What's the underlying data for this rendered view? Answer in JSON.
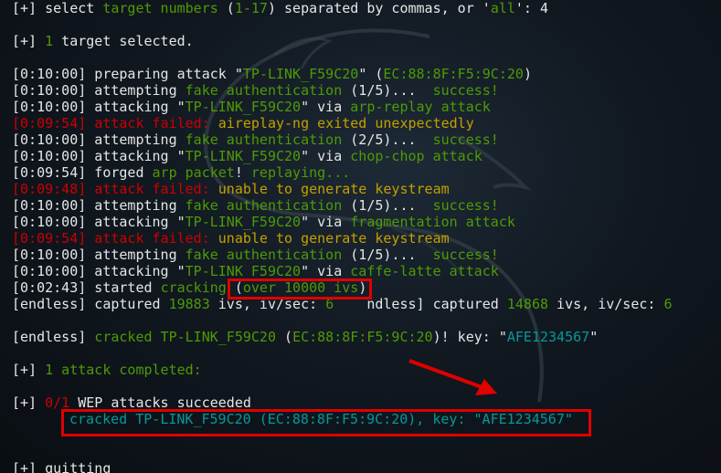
{
  "l01": {
    "a": "[+] select ",
    "b": "target numbers",
    "c": " (",
    "d": "1-17",
    "e": ") separated by commas, or '",
    "f": "all",
    "g": "': 4"
  },
  "l02": {
    "a": "[+] ",
    "b": "1",
    "c": " target selected."
  },
  "l03": {
    "a": "[0:10:00] preparing attack \"",
    "b": "TP-LINK_F59C20",
    "c": "\" (",
    "d": "EC:88:8F:F5:9C:20",
    "e": ")"
  },
  "l04": {
    "a": "[0:10:00] attempting ",
    "b": "fake authentication",
    "c": " (1/5)...  ",
    "d": "success!"
  },
  "l05": {
    "a": "[0:10:00] attacking \"",
    "b": "TP-LINK_F59C20",
    "c": "\" via ",
    "d": "arp-replay attack"
  },
  "l06": {
    "a": "[0:09:54] ",
    "b": "attack failed: ",
    "c": "aireplay-ng exited unexpectedly"
  },
  "l07": {
    "a": "[0:10:00] attempting ",
    "b": "fake authentication",
    "c": " (2/5)...  ",
    "d": "success!"
  },
  "l08": {
    "a": "[0:10:00] attacking \"",
    "b": "TP-LINK_F59C20",
    "c": "\" via ",
    "d": "chop-chop attack"
  },
  "l09": {
    "a": "[0:09:54] forged ",
    "b": "arp packet",
    "c": "! ",
    "d": "replaying..."
  },
  "l10": {
    "a": "[0:09:48] ",
    "b": "attack failed: ",
    "c": "unable to generate keystream"
  },
  "l11": {
    "a": "[0:10:00] attempting ",
    "b": "fake authentication",
    "c": " (1/5)...  ",
    "d": "success!"
  },
  "l12": {
    "a": "[0:10:00] attacking \"",
    "b": "TP-LINK_F59C20",
    "c": "\" via ",
    "d": "fragmentation attack"
  },
  "l13": {
    "a": "[0:09:54] ",
    "b": "attack failed: ",
    "c": "unable to generate keystream"
  },
  "l14": {
    "a": "[0:10:00] attempting ",
    "b": "fake authentication",
    "c": " (1/5)...  ",
    "d": "success!"
  },
  "l15": {
    "a": "[0:10:00] attacking \"",
    "b": "TP-LINK_F59C20",
    "c": "\" via ",
    "d": "caffe-latte attack"
  },
  "l16": {
    "a": "[0:02:43] started ",
    "b": "cracking",
    "c": " (",
    "d": "over 10000 ivs",
    "e": ")"
  },
  "l17": {
    "a": "[endless] captured ",
    "b": "19883",
    "c": " ivs, iv/sec: ",
    "d": "6",
    "e": "    ndless] captured ",
    "f": "14868",
    "g": " ivs, iv/sec: ",
    "h": "6"
  },
  "l18": {
    "a": "[endless] ",
    "b": "cracked TP-LINK_F59C20",
    "c": " (",
    "d": "EC:88:8F:F5:9C:20",
    "e": ")! key: \"",
    "f": "AFE1234567",
    "g": "\""
  },
  "l19": {
    "a": "[+] ",
    "b": "1 attack completed:"
  },
  "l20": {
    "a": "[+] ",
    "b": "0/1",
    "c": " WEP attacks succeeded"
  },
  "l21": {
    "a": "cracked TP-LINK_F59C20 (EC:88:8F:F5:9C:20), key: \"AFE1234567\""
  },
  "l22": {
    "a": "[+] quitting"
  }
}
